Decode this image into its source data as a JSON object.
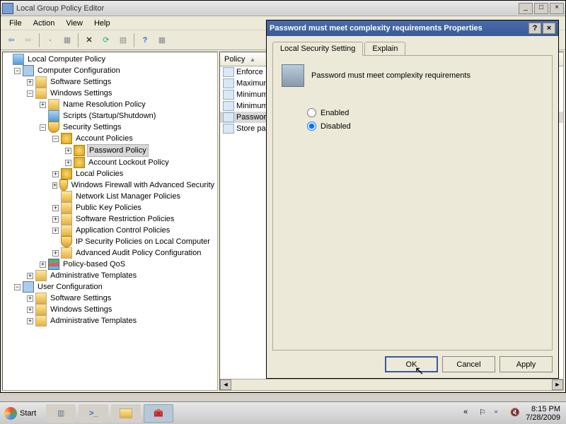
{
  "window": {
    "title": "Local Group Policy Editor"
  },
  "menubar": [
    "File",
    "Action",
    "View",
    "Help"
  ],
  "tree": {
    "root": "Local Computer Policy",
    "computer_config": "Computer Configuration",
    "cc_software": "Software Settings",
    "cc_windows": "Windows Settings",
    "name_res": "Name Resolution Policy",
    "scripts": "Scripts (Startup/Shutdown)",
    "security": "Security Settings",
    "account_policies": "Account Policies",
    "password_policy": "Password Policy",
    "lockout_policy": "Account Lockout Policy",
    "local_policies": "Local Policies",
    "firewall": "Windows Firewall with Advanced Security",
    "network_list": "Network List Manager Policies",
    "public_key": "Public Key Policies",
    "software_restriction": "Software Restriction Policies",
    "app_control": "Application Control Policies",
    "ip_security": "IP Security Policies on Local Computer",
    "advanced_audit": "Advanced Audit Policy Configuration",
    "qos": "Policy-based QoS",
    "cc_admin": "Administrative Templates",
    "user_config": "User Configuration",
    "uc_software": "Software Settings",
    "uc_windows": "Windows Settings",
    "uc_admin": "Administrative Templates"
  },
  "list": {
    "header": "Policy",
    "items": [
      "Enforce",
      "Maximum",
      "Minimum",
      "Minimum",
      "Password",
      "Store pa"
    ]
  },
  "dialog": {
    "title": "Password must meet complexity requirements Properties",
    "tab1": "Local Security Setting",
    "tab2": "Explain",
    "heading": "Password must meet complexity requirements",
    "enabled": "Enabled",
    "disabled": "Disabled",
    "selected": "disabled",
    "ok": "OK",
    "cancel": "Cancel",
    "apply": "Apply"
  },
  "taskbar": {
    "start": "Start",
    "time": "8:15 PM",
    "date": "7/28/2009"
  }
}
